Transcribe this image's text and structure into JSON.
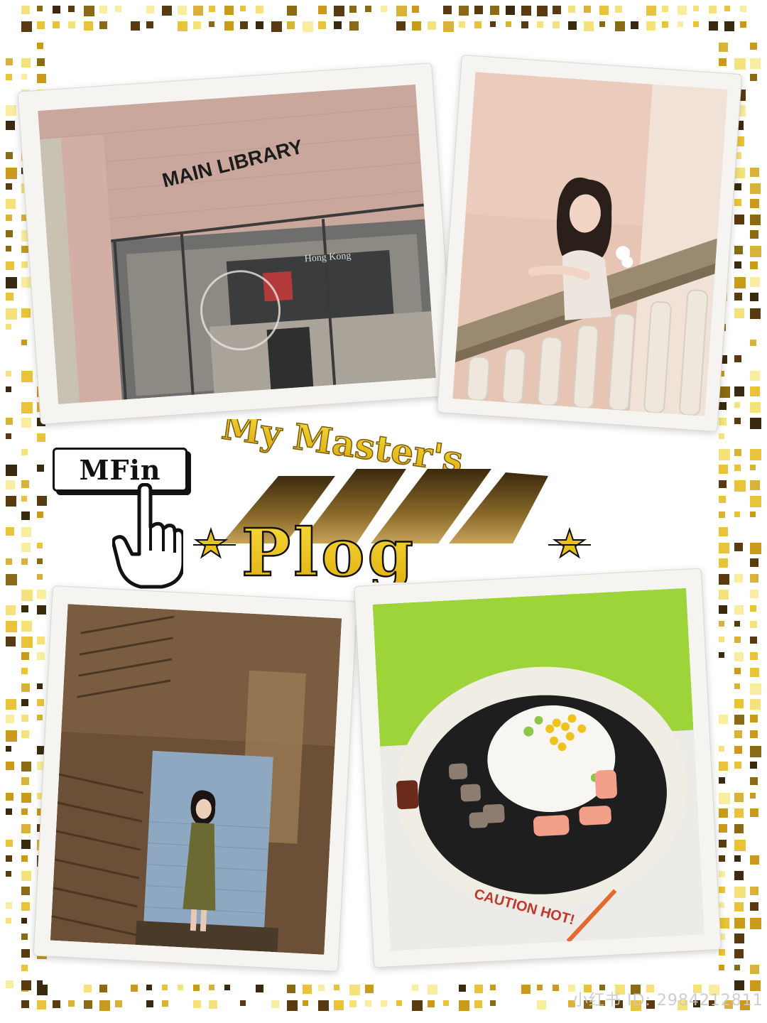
{
  "title": {
    "line1": "My Master's",
    "line2": "Plog"
  },
  "badge": {
    "label": "MFin"
  },
  "photos": {
    "library": {
      "sign_text": "MAIN LIBRARY",
      "glass_text": "Hong Kong"
    },
    "railing": {},
    "stairwell": {},
    "food": {
      "caution_text": "CAUTION HOT!"
    }
  },
  "watermark": {
    "text": "小红书 ID: 2984212811"
  },
  "colors": {
    "gold": "#e8c21a",
    "gold_dark": "#8a6a14",
    "brown": "#5a3a10",
    "frame": "#f6f4f1"
  }
}
